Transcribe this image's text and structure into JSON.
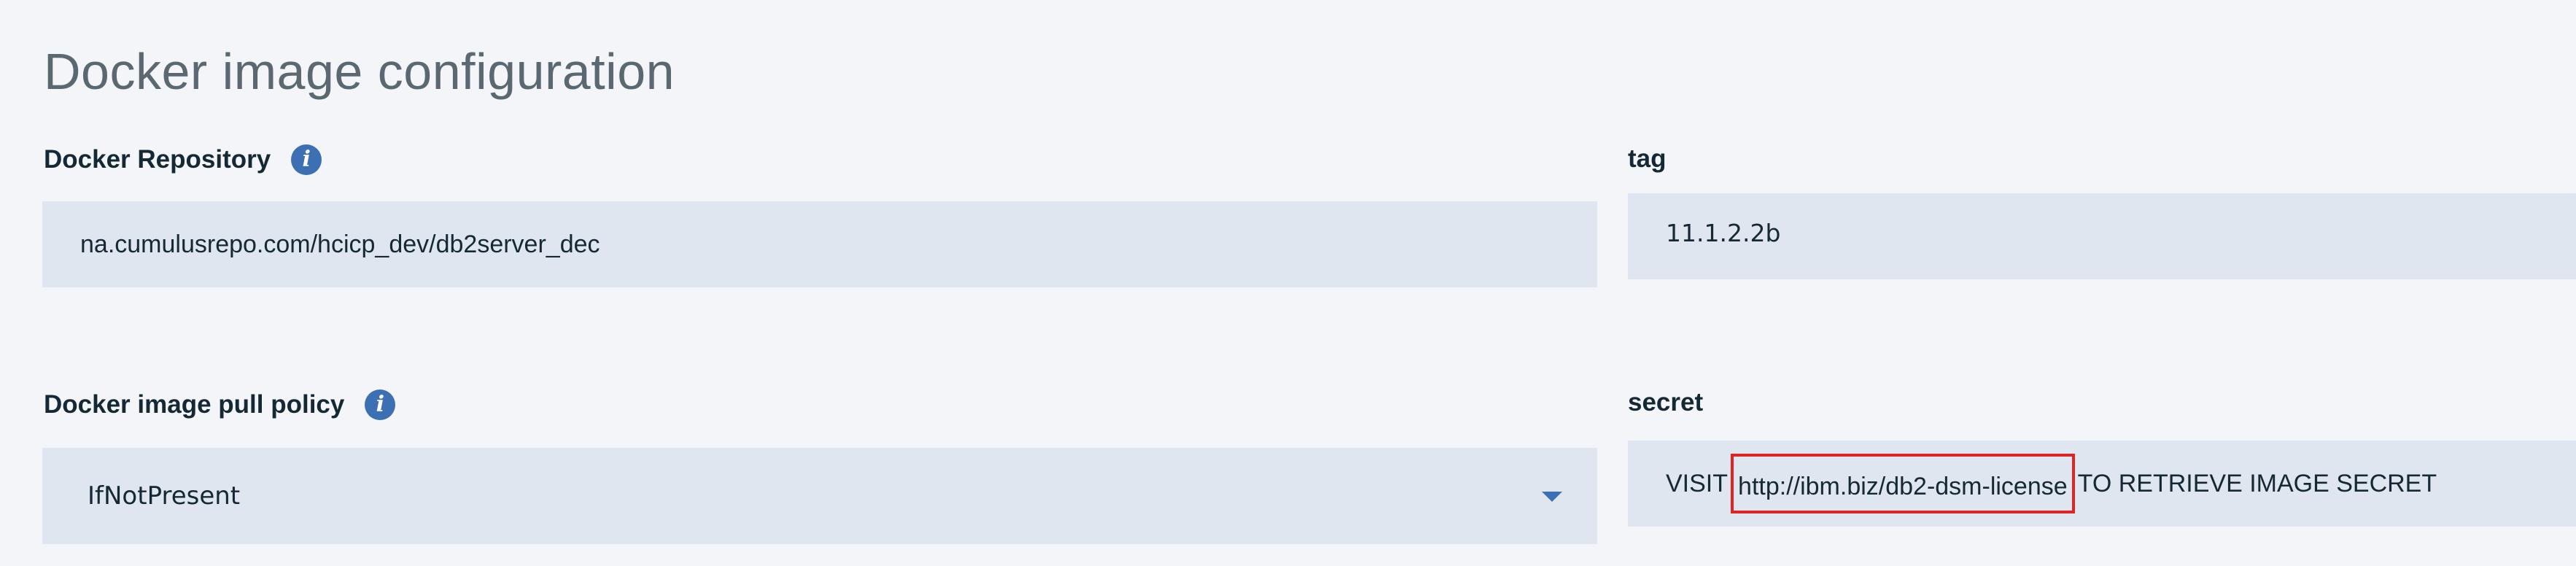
{
  "section": {
    "title": "Docker image configuration"
  },
  "fields": {
    "repository": {
      "label": "Docker Repository",
      "value": "na.cumulusrepo.com/hcicp_dev/db2server_dec"
    },
    "tag": {
      "label": "tag",
      "value": "11.1.2.2b"
    },
    "pull_policy": {
      "label": "Docker image pull policy",
      "selected": "IfNotPresent"
    },
    "secret": {
      "label": "secret",
      "prefix": "VISIT",
      "link": "http://ibm.biz/db2-dsm-license",
      "suffix": "TO RETRIEVE IMAGE SECRET"
    }
  },
  "icons": {
    "info_glyph": "i"
  },
  "colors": {
    "background": "#f4f5f8",
    "input_background": "#dfe6ef",
    "accent": "#3d70b2",
    "highlight": "#e02424"
  }
}
